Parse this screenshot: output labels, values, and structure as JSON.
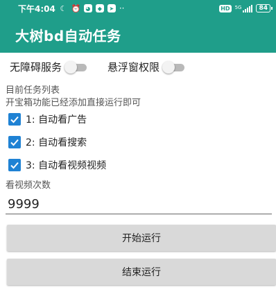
{
  "status_bar": {
    "time": "下午4:04",
    "left_icons": [
      "moon-icon",
      "alarm-icon",
      "app-notification-icon",
      "shield-notification-icon",
      "send-notification-icon"
    ],
    "more": "··",
    "hd": "HD",
    "network": "5G",
    "battery": "84"
  },
  "app": {
    "title": "大树bd自动任务"
  },
  "switches": [
    {
      "label": "无障碍服务",
      "on": false
    },
    {
      "label": "悬浮窗权限",
      "on": false
    }
  ],
  "task_section": {
    "heading": "目前任务列表",
    "note": "开宝箱功能已经添加直接运行即可"
  },
  "tasks": [
    {
      "label": "1: 自动看广告",
      "checked": true
    },
    {
      "label": "2: 自动看搜索",
      "checked": true
    },
    {
      "label": "3: 自动看视频视频",
      "checked": true
    }
  ],
  "video_count": {
    "label": "看视频次数",
    "value": "9999"
  },
  "buttons": {
    "start": "开始运行",
    "stop": "结束运行"
  },
  "colors": {
    "primary": "#1f9e8a",
    "checkbox": "#1f82d4",
    "button_bg": "#d9d9d9"
  }
}
